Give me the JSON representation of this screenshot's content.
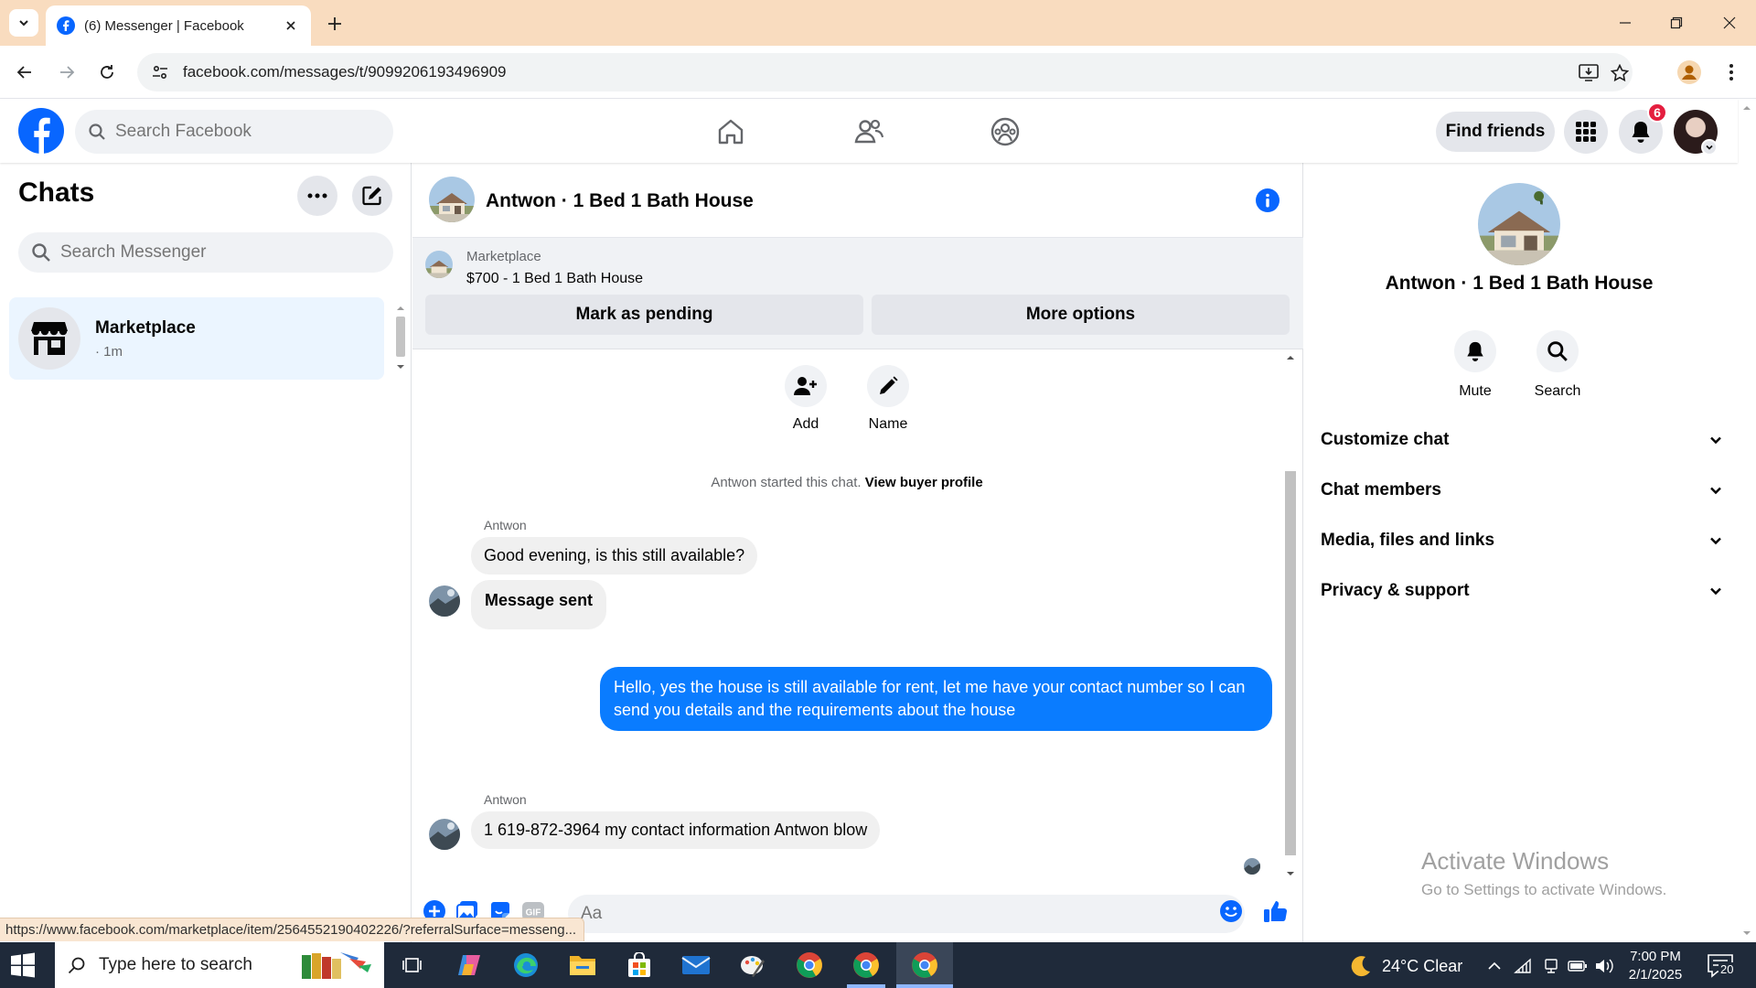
{
  "browser": {
    "tab_title": "(6) Messenger | Facebook",
    "url": "facebook.com/messages/t/9099206193496909",
    "status_url": "https://www.facebook.com/marketplace/item/2564552190402226/?referralSurface=messeng..."
  },
  "fb_header": {
    "search_placeholder": "Search Facebook",
    "find_friends_label": "Find friends",
    "notification_count": "6"
  },
  "chats_panel": {
    "title": "Chats",
    "search_placeholder": "Search Messenger",
    "items": [
      {
        "name": "Marketplace",
        "time": "· 1m"
      }
    ]
  },
  "conversation": {
    "title": "Antwon · 1 Bed 1 Bath House",
    "marketplace_label": "Marketplace",
    "listing": "$700 - 1 Bed 1 Bath House",
    "mark_pending_label": "Mark as pending",
    "more_options_label": "More options",
    "actions": [
      {
        "label": "Add"
      },
      {
        "label": "Name"
      }
    ],
    "started_text": "Antwon started this chat.",
    "view_profile_label": "View buyer profile",
    "messages": [
      {
        "sender": "Antwon",
        "text": "Good evening, is this still available?"
      },
      {
        "text": "Message sent"
      },
      {
        "text": "Hello, yes the house is still available for rent, let me have your contact number so I can send you details and the requirements about the house"
      },
      {
        "sender": "Antwon",
        "text": "1 619-872-3964 my contact information Antwon blow"
      }
    ],
    "composer_placeholder": "Aa",
    "gif_label": "GIF"
  },
  "info_panel": {
    "name": "Antwon · 1 Bed 1 Bath House",
    "mute_label": "Mute",
    "search_label": "Search",
    "sections": [
      "Customize chat",
      "Chat members",
      "Media, files and links",
      "Privacy & support"
    ]
  },
  "watermark": {
    "title": "Activate Windows",
    "subtitle": "Go to Settings to activate Windows."
  },
  "taskbar": {
    "search_placeholder": "Type here to search",
    "weather": "24°C  Clear",
    "time": "7:00 PM",
    "date": "2/1/2025",
    "notification_count": "20"
  },
  "colors": {
    "fb_blue": "#0866ff",
    "message_blue": "#0a7cff",
    "tab_strip": "#f9dcbf",
    "badge_red": "#e41e3f"
  }
}
